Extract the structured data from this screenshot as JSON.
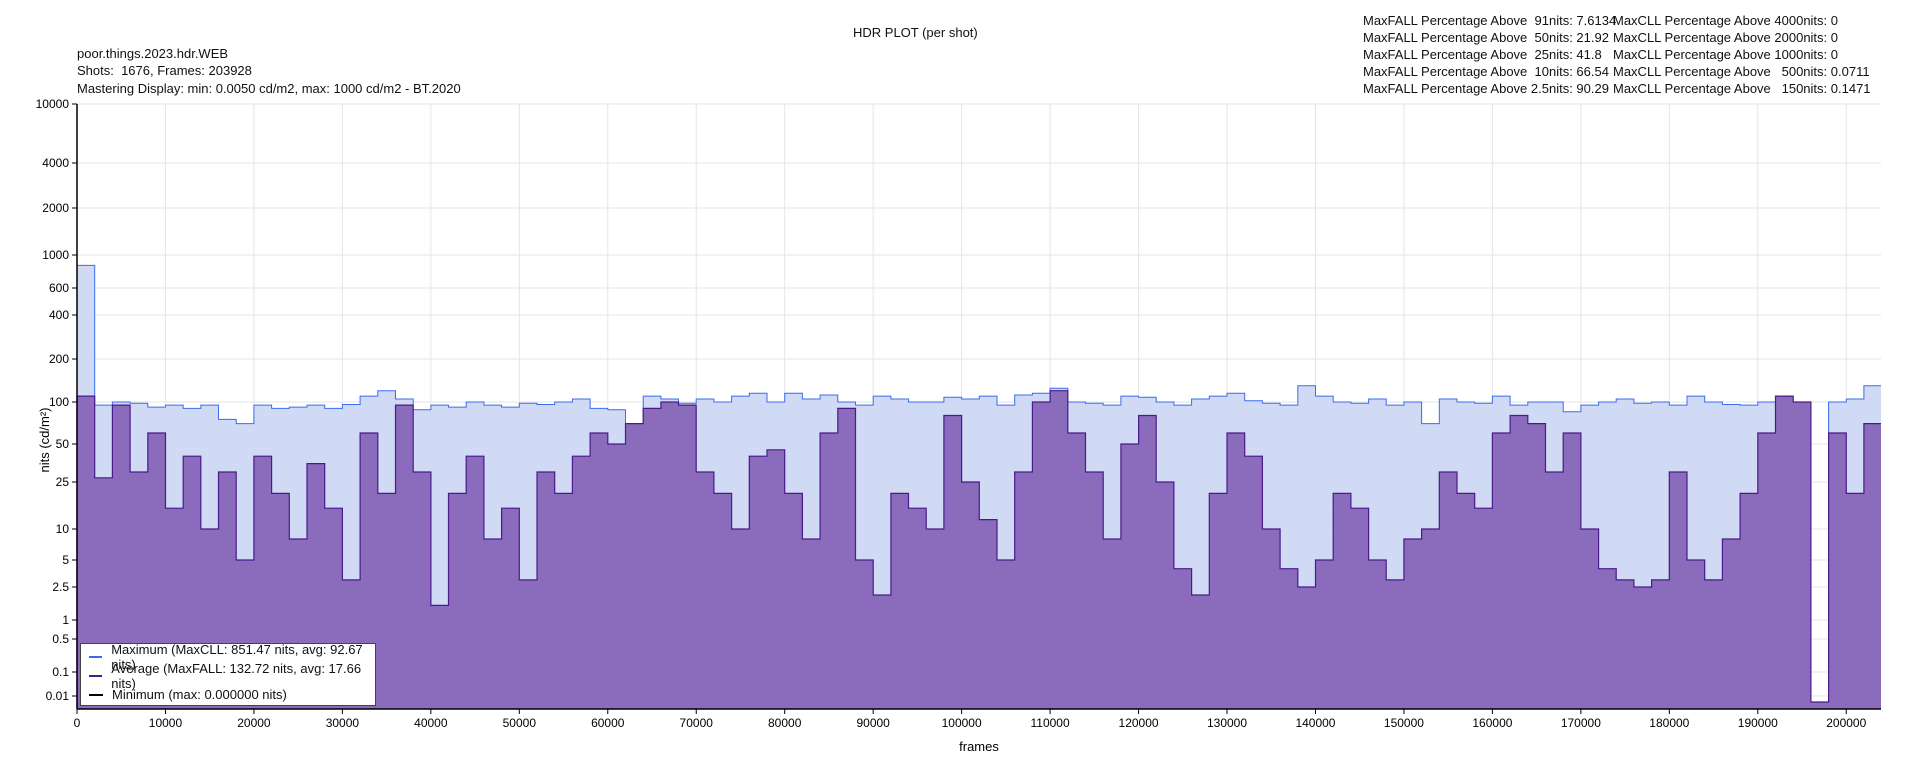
{
  "title": "HDR PLOT (per shot)",
  "info": {
    "name": "poor.things.2023.hdr.WEB",
    "shots": "Shots:  1676, Frames: 203928",
    "mastering": "Mastering Display: min: 0.0050 cd/m2, max: 1000 cd/m2 - BT.2020"
  },
  "stats_maxfall": [
    "MaxFALL Percentage Above  91nits: 7.6134",
    "MaxFALL Percentage Above  50nits: 21.92",
    "MaxFALL Percentage Above  25nits: 41.8",
    "MaxFALL Percentage Above  10nits: 66.54",
    "MaxFALL Percentage Above 2.5nits: 90.29"
  ],
  "stats_maxcll": [
    "MaxCLL Percentage Above 4000nits: 0",
    "MaxCLL Percentage Above 2000nits: 0",
    "MaxCLL Percentage Above 1000nits: 0",
    "MaxCLL Percentage Above   500nits: 0.0711",
    "MaxCLL Percentage Above   150nits: 0.1471"
  ],
  "colors": {
    "max": "#3a6cf0",
    "max_fill": "#d0daf5",
    "avg": "#4a1a8c",
    "avg_fill": "#8b6bbb",
    "min": "#000000"
  },
  "chart_data": {
    "type": "area",
    "title": "HDR PLOT (per shot)",
    "xlabel": "frames",
    "ylabel": "nits (cd/m²)",
    "xlim": [
      0,
      203928
    ],
    "ylim": [
      0.005,
      10000
    ],
    "yscale": "PQ-like",
    "grid": true,
    "legend_position": "bottom-left",
    "xticks": [
      "0",
      "10000",
      "20000",
      "30000",
      "40000",
      "50000",
      "60000",
      "70000",
      "80000",
      "90000",
      "100000",
      "110000",
      "120000",
      "130000",
      "140000",
      "150000",
      "160000",
      "170000",
      "180000",
      "190000",
      "200000"
    ],
    "yticks": [
      "10000",
      "4000",
      "2000",
      "1000",
      "600",
      "400",
      "200",
      "100",
      "50",
      "25",
      "10",
      "5",
      "2.5",
      "1",
      "0.5",
      "0.1",
      "0.01"
    ],
    "legend": [
      "Maximum (MaxCLL: 851.47 nits, avg: 92.67 nits)",
      "Average (MaxFALL: 132.72 nits, avg: 17.66 nits)",
      "Minimum (max: 0.000000 nits)"
    ],
    "x_step": 2000,
    "series": [
      {
        "name": "Maximum",
        "values": [
          851,
          95,
          100,
          98,
          92,
          95,
          90,
          95,
          75,
          70,
          95,
          90,
          92,
          95,
          90,
          96,
          110,
          120,
          105,
          88,
          95,
          92,
          100,
          95,
          92,
          98,
          96,
          100,
          105,
          90,
          88,
          70,
          110,
          105,
          98,
          105,
          100,
          110,
          115,
          100,
          115,
          105,
          112,
          100,
          95,
          110,
          105,
          100,
          100,
          108,
          105,
          110,
          95,
          112,
          115,
          125,
          100,
          98,
          95,
          110,
          108,
          100,
          95,
          105,
          110,
          115,
          102,
          98,
          95,
          130,
          110,
          100,
          98,
          105,
          95,
          100,
          70,
          105,
          100,
          98,
          110,
          95,
          100,
          100,
          85,
          95,
          100,
          105,
          98,
          100,
          95,
          110,
          100,
          96,
          95,
          100,
          105,
          100,
          0.005,
          100,
          105,
          130
        ]
      },
      {
        "name": "Average",
        "values": [
          110,
          27,
          95,
          30,
          60,
          15,
          40,
          10,
          30,
          5,
          40,
          20,
          8,
          35,
          15,
          3,
          60,
          20,
          95,
          30,
          1.5,
          20,
          40,
          8,
          15,
          3,
          30,
          20,
          40,
          60,
          50,
          70,
          90,
          100,
          95,
          30,
          20,
          10,
          40,
          45,
          20,
          8,
          60,
          90,
          5,
          2,
          20,
          15,
          10,
          80,
          25,
          12,
          5,
          30,
          100,
          120,
          60,
          30,
          8,
          50,
          80,
          25,
          4,
          2,
          20,
          60,
          40,
          10,
          4,
          2.5,
          5,
          20,
          15,
          5,
          3,
          8,
          10,
          30,
          20,
          15,
          60,
          80,
          70,
          30,
          60,
          10,
          4,
          3,
          2.5,
          3,
          30,
          5,
          3,
          8,
          20,
          60,
          110,
          100,
          0.005,
          60,
          20,
          70
        ]
      },
      {
        "name": "Minimum",
        "values": [
          0
        ]
      }
    ]
  }
}
